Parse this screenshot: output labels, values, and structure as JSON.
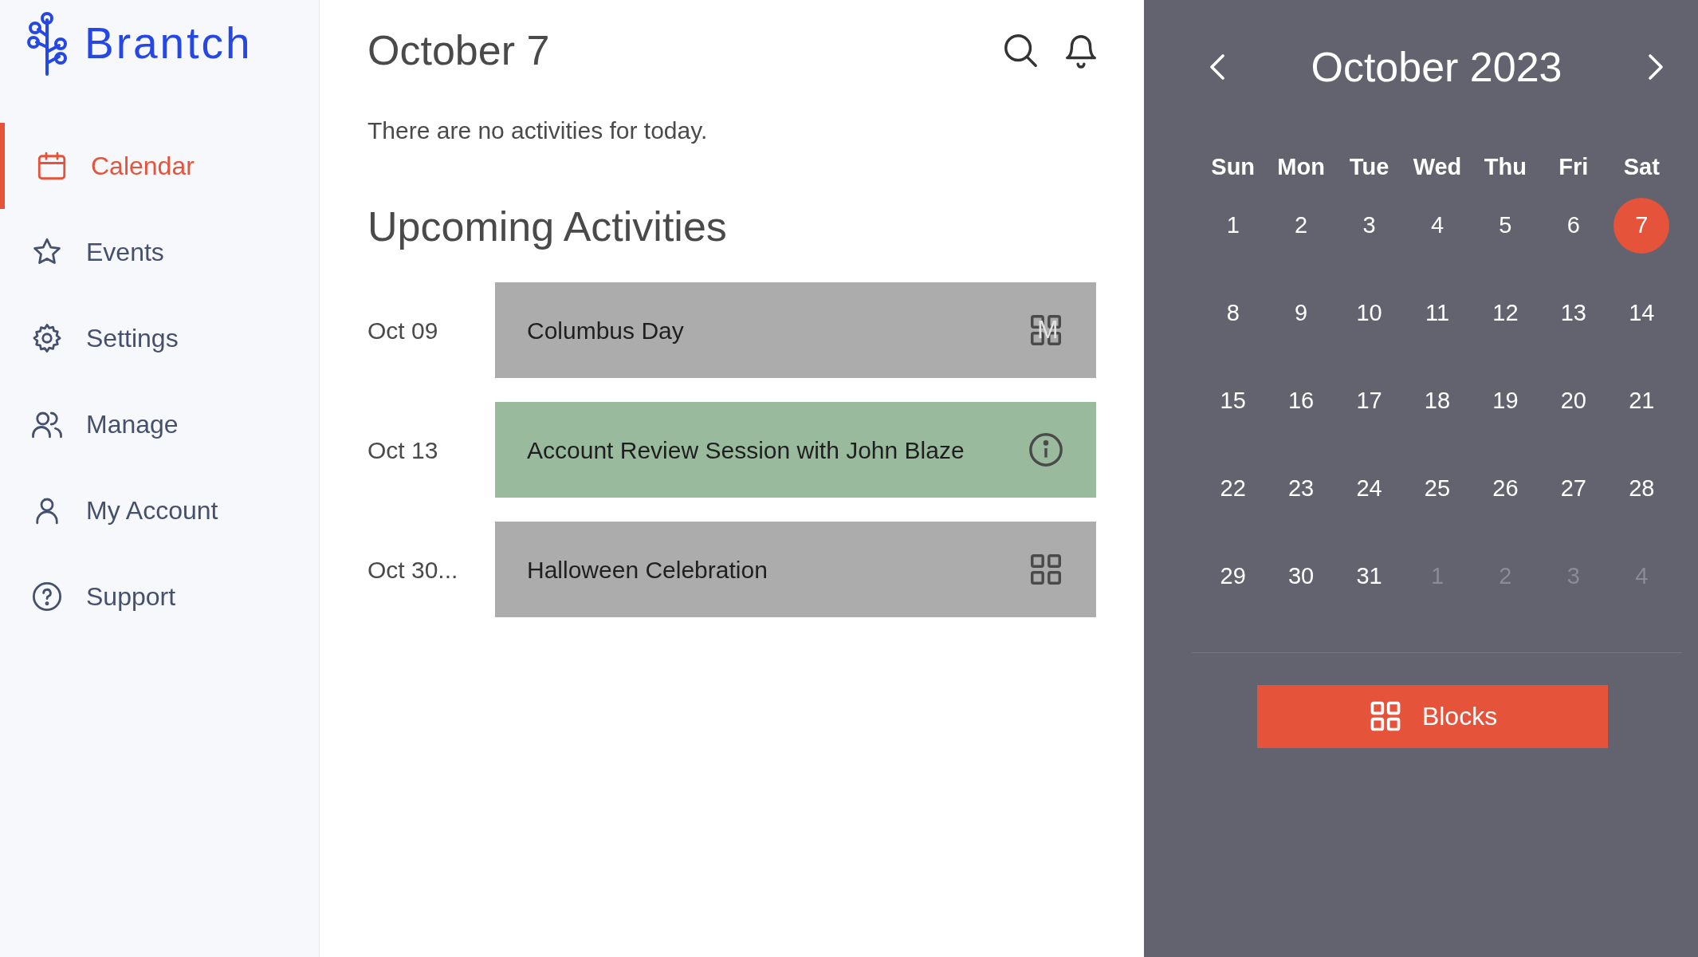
{
  "brand": "Brantch",
  "nav": [
    {
      "label": "Calendar",
      "kind": "calendar",
      "selected": true
    },
    {
      "label": "Events",
      "kind": "star",
      "selected": false
    },
    {
      "label": "Settings",
      "kind": "gear",
      "selected": false
    },
    {
      "label": "Manage",
      "kind": "users",
      "selected": false
    },
    {
      "label": "My Account",
      "kind": "user",
      "selected": false
    },
    {
      "label": "Support",
      "kind": "help",
      "selected": false
    }
  ],
  "main": {
    "title": "October 7",
    "empty_message": "There are no activities for today.",
    "upcoming_heading": "Upcoming Activities",
    "activities": [
      {
        "date": "Oct 09",
        "title": "Columbus Day",
        "kind": "block",
        "icon_text": "M"
      },
      {
        "date": "Oct 13",
        "title": "Account Review Session with John Blaze",
        "kind": "session"
      },
      {
        "date": "Oct 30...",
        "title": "Halloween Celebration",
        "kind": "block"
      }
    ]
  },
  "calendar": {
    "month": "October 2023",
    "weekdays": [
      "Sun",
      "Mon",
      "Tue",
      "Wed",
      "Thu",
      "Fri",
      "Sat"
    ],
    "days": [
      {
        "day": "1",
        "other_month": false,
        "selected": false
      },
      {
        "day": "2",
        "other_month": false,
        "selected": false
      },
      {
        "day": "3",
        "other_month": false,
        "selected": false
      },
      {
        "day": "4",
        "other_month": false,
        "selected": false
      },
      {
        "day": "5",
        "other_month": false,
        "selected": false
      },
      {
        "day": "6",
        "other_month": false,
        "selected": false
      },
      {
        "day": "7",
        "other_month": false,
        "selected": true
      },
      {
        "day": "8",
        "other_month": false,
        "selected": false
      },
      {
        "day": "9",
        "other_month": false,
        "selected": false
      },
      {
        "day": "10",
        "other_month": false,
        "selected": false
      },
      {
        "day": "11",
        "other_month": false,
        "selected": false
      },
      {
        "day": "12",
        "other_month": false,
        "selected": false
      },
      {
        "day": "13",
        "other_month": false,
        "selected": false
      },
      {
        "day": "14",
        "other_month": false,
        "selected": false
      },
      {
        "day": "15",
        "other_month": false,
        "selected": false
      },
      {
        "day": "16",
        "other_month": false,
        "selected": false
      },
      {
        "day": "17",
        "other_month": false,
        "selected": false
      },
      {
        "day": "18",
        "other_month": false,
        "selected": false
      },
      {
        "day": "19",
        "other_month": false,
        "selected": false
      },
      {
        "day": "20",
        "other_month": false,
        "selected": false
      },
      {
        "day": "21",
        "other_month": false,
        "selected": false
      },
      {
        "day": "22",
        "other_month": false,
        "selected": false
      },
      {
        "day": "23",
        "other_month": false,
        "selected": false
      },
      {
        "day": "24",
        "other_month": false,
        "selected": false
      },
      {
        "day": "25",
        "other_month": false,
        "selected": false
      },
      {
        "day": "26",
        "other_month": false,
        "selected": false
      },
      {
        "day": "27",
        "other_month": false,
        "selected": false
      },
      {
        "day": "28",
        "other_month": false,
        "selected": false
      },
      {
        "day": "29",
        "other_month": false,
        "selected": false
      },
      {
        "day": "30",
        "other_month": false,
        "selected": false
      },
      {
        "day": "31",
        "other_month": false,
        "selected": false
      },
      {
        "day": "1",
        "other_month": true,
        "selected": false
      },
      {
        "day": "2",
        "other_month": true,
        "selected": false
      },
      {
        "day": "3",
        "other_month": true,
        "selected": false
      },
      {
        "day": "4",
        "other_month": true,
        "selected": false
      }
    ],
    "button": "Blocks"
  }
}
